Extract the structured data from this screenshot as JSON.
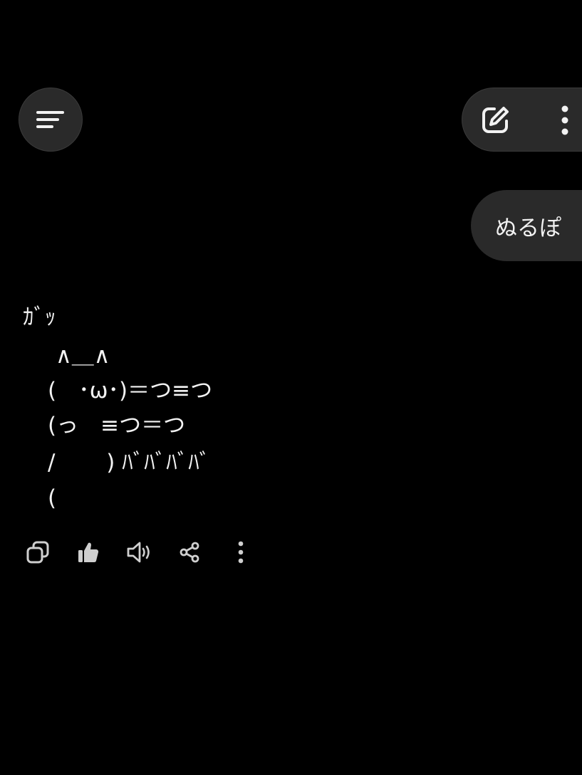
{
  "header": {
    "menu_icon": "menu-icon",
    "edit_icon": "edit-icon",
    "more_icon": "more-vertical-icon"
  },
  "user_message": {
    "text": "ぬるぽ"
  },
  "assistant_message": {
    "lines": [
      "ｶﾞｯ",
      "∧＿∧",
      "(　･ω･)＝つ≡つ",
      "(っ　≡つ＝つ",
      "/　　 ) ﾊﾞﾊﾞﾊﾞﾊﾞ",
      "("
    ]
  },
  "actions": {
    "copy_icon": "copy-icon",
    "like_icon": "thumbs-up-icon",
    "speak_icon": "speaker-icon",
    "share_icon": "share-icon",
    "more_icon": "more-vertical-icon"
  },
  "colors": {
    "background": "#000000",
    "surface": "#2a2a2a",
    "text": "#f2f2f2"
  }
}
